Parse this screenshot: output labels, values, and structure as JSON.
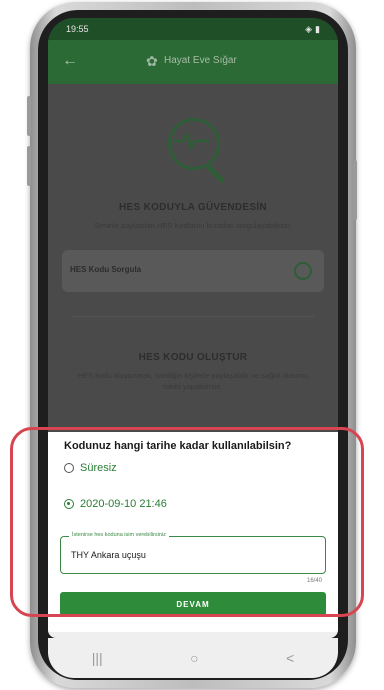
{
  "status_bar": {
    "time": "19:55"
  },
  "app_bar": {
    "title": "Hayat Eve Sığar"
  },
  "main": {
    "section1_title": "HES KODUYLA GÜVENDESİN",
    "section1_subtitle": "Seninle paylaşılan HES Kodlarını buradan sorgulayabilirsin.",
    "query_label": "HES Kodu Sorgula",
    "section2_title": "HES KODU OLUŞTUR",
    "section2_subtitle": "HES kodu oluşturarak, istediğin kişilerle paylaşabilir ve sağlık durumu takibi yapabilirsin."
  },
  "sheet": {
    "title": "Kodunuz hangi tarihe kadar kullanılabilsin?",
    "option_unlimited": "Süresiz",
    "option_date": "2020-09-10 21:46",
    "selected_option": "date",
    "field_label": "İstenirse hes koduna isim verebilirsiniz",
    "field_value": "THY Ankara uçuşu",
    "counter": "16/40",
    "button_label": "DEVAM"
  },
  "system_nav": {
    "recent": "|||",
    "home": "○",
    "back": "<"
  },
  "colors": {
    "accent": "#2e8b3a",
    "highlight": "#d64550",
    "app_bar": "#2b6a34"
  }
}
